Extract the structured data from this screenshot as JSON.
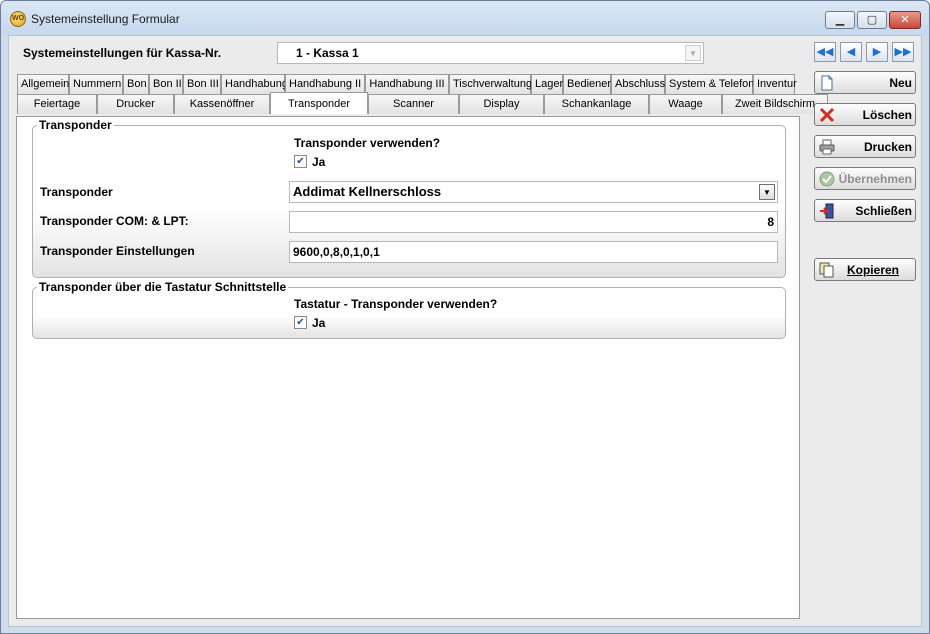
{
  "window": {
    "title": "Systemeinstellung Formular",
    "icon": "wo-app-icon",
    "controls": {
      "minimize": "▁",
      "maximize": "▢",
      "close": "✕"
    }
  },
  "header": {
    "label": "Systemeinstellungen für Kassa-Nr.",
    "kassa_value": "1 - Kassa 1"
  },
  "tabs_row1": [
    "Allgemein",
    "Nummern",
    "Bon",
    "Bon II",
    "Bon III",
    "Handhabung",
    "Handhabung II",
    "Handhabung III",
    "Tischverwaltung",
    "Lager",
    "Bediener",
    "Abschluss",
    "System & Telefon",
    "Inventur"
  ],
  "tabs_row2": [
    "Feiertage",
    "Drucker",
    "Kassenöffner",
    "Transponder",
    "Scanner",
    "Display",
    "Schankanlage",
    "Waage",
    "Zweit Bildschirm"
  ],
  "active_tab": "Transponder",
  "group1": {
    "title": "Transponder",
    "use_question": "Transponder verwenden?",
    "use_check_label": "Ja",
    "use_checked": true,
    "transponder_label": "Transponder",
    "transponder_value": "Addimat Kellnerschloss",
    "com_label": "Transponder COM: & LPT:",
    "com_value": "8",
    "settings_label": "Transponder Einstellungen",
    "settings_value": "9600,0,8,0,1,0,1"
  },
  "group2": {
    "title": "Transponder über die Tastatur Schnittstelle",
    "use_question": "Tastatur - Transponder verwenden?",
    "use_check_label": "Ja",
    "use_checked": true
  },
  "sidebar": {
    "nav": {
      "first": "◀◀",
      "prev": "◀",
      "next": "▶",
      "last": "▶▶"
    },
    "buttons": {
      "new": "Neu",
      "delete": "Löschen",
      "print": "Drucken",
      "apply": "Übernehmen",
      "close": "Schließen",
      "copy": "Kopieren"
    }
  },
  "colors": {
    "accent": "#1f6fd6",
    "delete": "#d42b1e"
  }
}
